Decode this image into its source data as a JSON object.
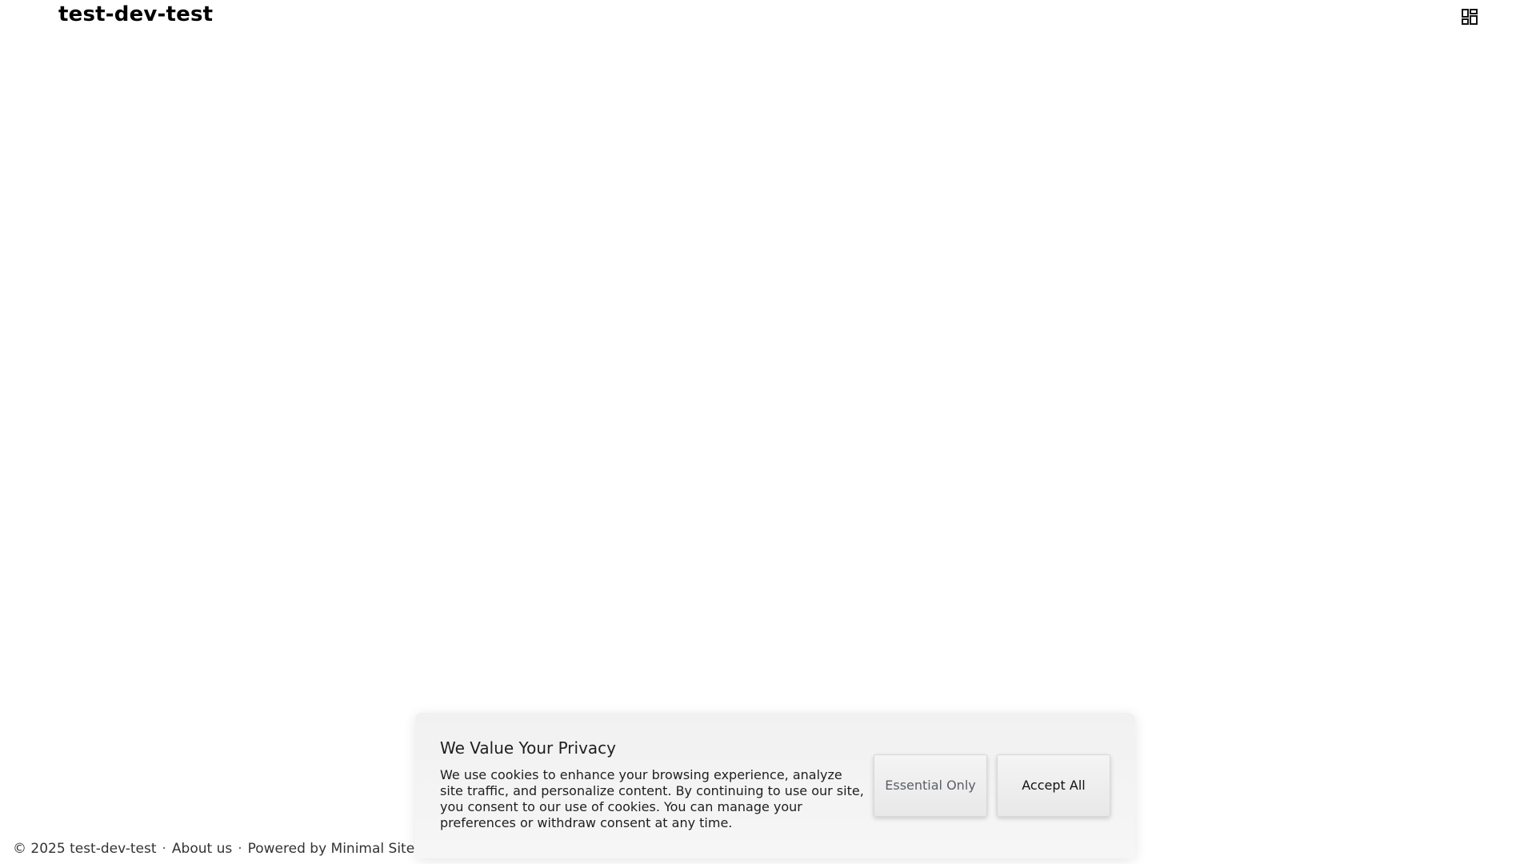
{
  "header": {
    "site_title": "test-dev-test",
    "menu_icon": "grid-dashboard-icon"
  },
  "footer": {
    "copyright": "© 2025 test-dev-test",
    "separator": "·",
    "about_link": "About us",
    "powered_by": "Powered by Minimal Site"
  },
  "cookie_banner": {
    "title": "We Value Your Privacy",
    "text": "We use cookies to enhance your browsing experience, analyze site traffic, and personalize content. By continuing to use our site, you consent to our use of cookies. You can manage your preferences or withdraw consent at any time.",
    "essential_label": "Essential Only",
    "accept_label": "Accept All"
  }
}
